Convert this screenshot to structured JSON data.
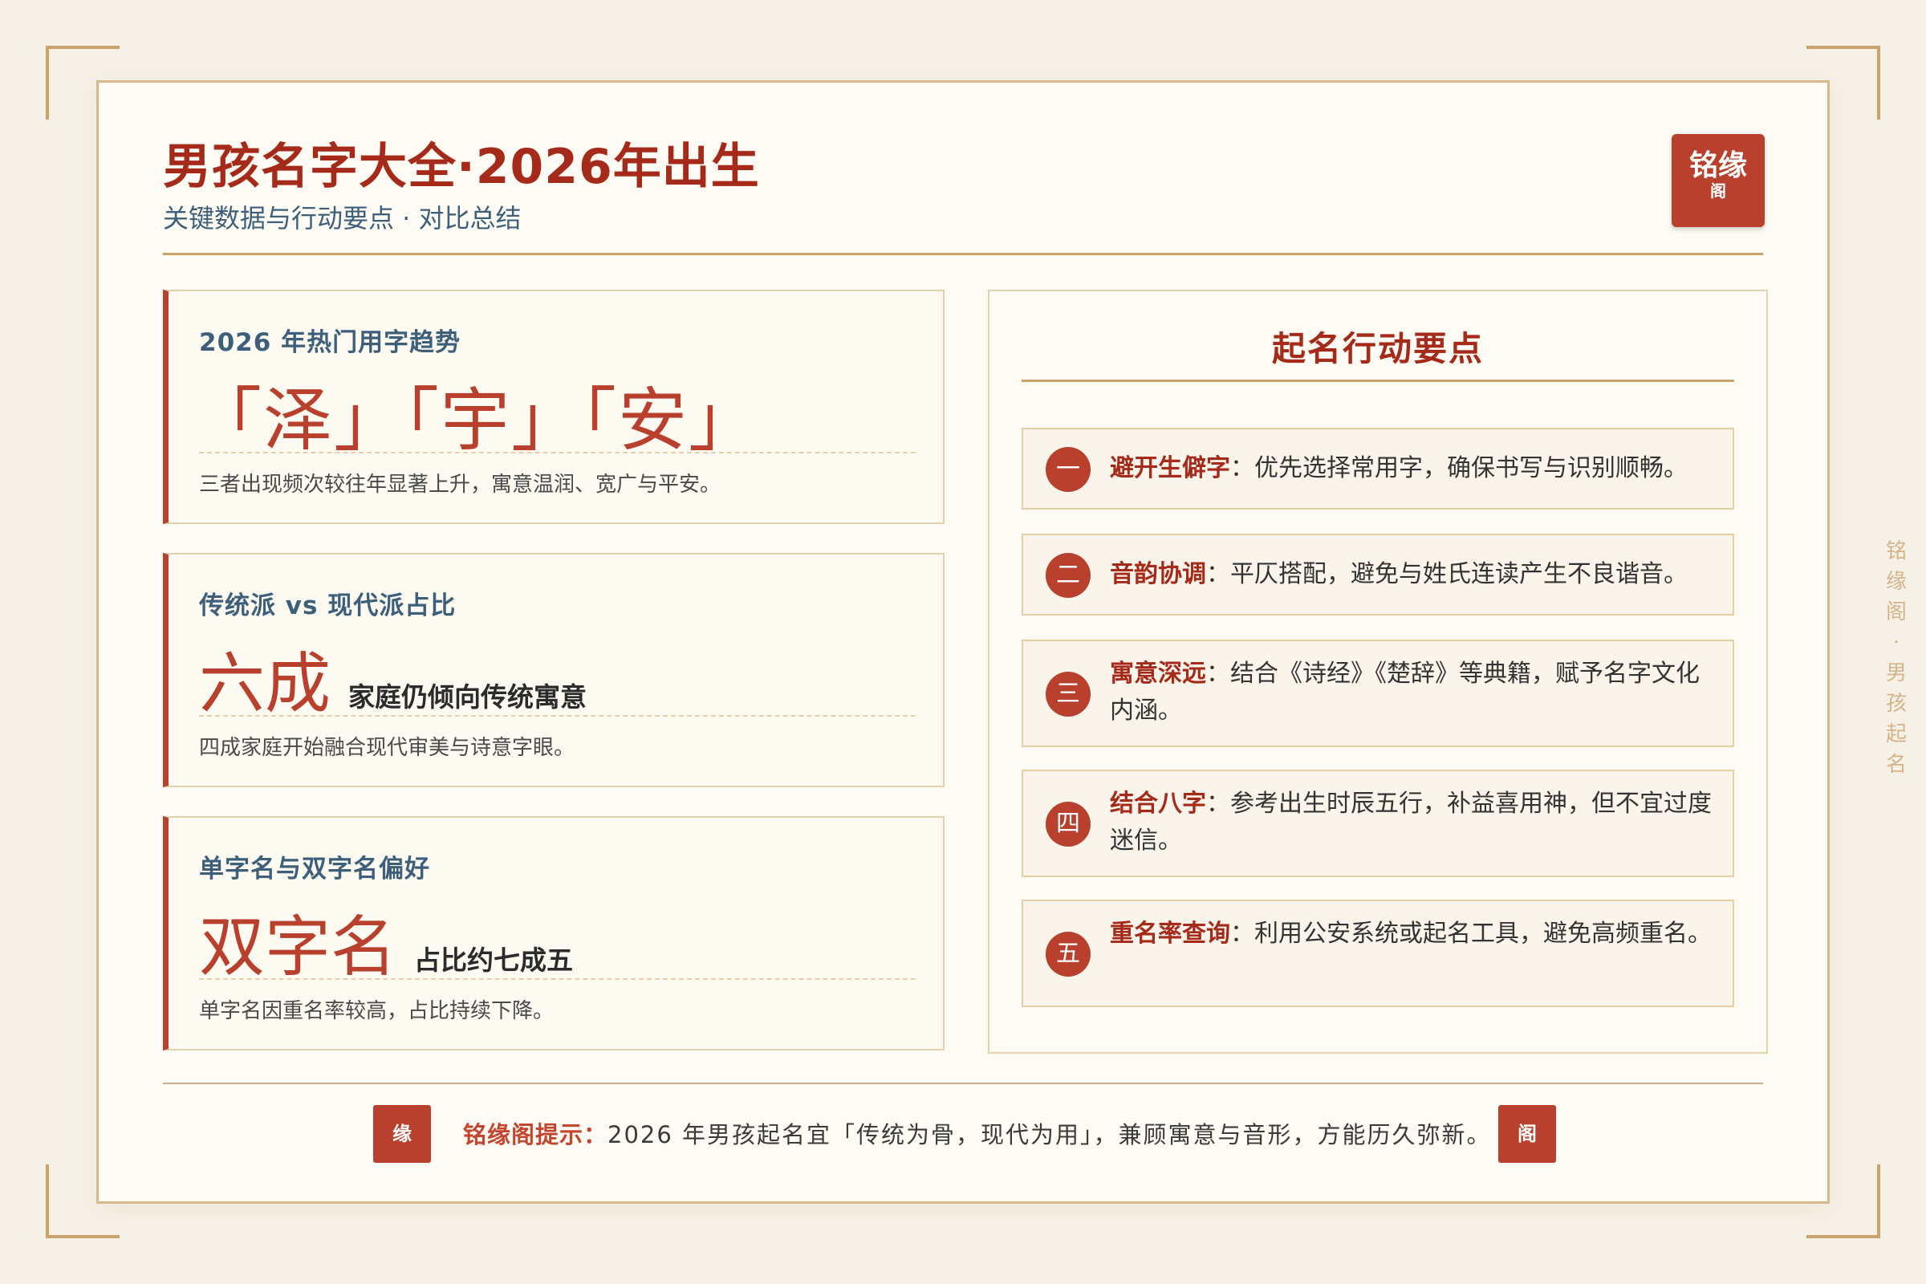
{
  "header": {
    "title": "男孩名字大全·2026年出生",
    "subtitle": "关键数据与行动要点 · 对比总结",
    "seal_main": "铭缘",
    "seal_small": "阁"
  },
  "stats": [
    {
      "label": "2026 年热门用字趋势",
      "big": "「泽」「宇」「安」",
      "note": "",
      "desc": "三者出现频次较往年显著上升，寓意温润、宽广与平安。"
    },
    {
      "label": "传统派 vs 现代派占比",
      "big": "六成",
      "note": "家庭仍倾向传统寓意",
      "desc": "四成家庭开始融合现代审美与诗意字眼。"
    },
    {
      "label": "单字名与双字名偏好",
      "big": "双字名",
      "note": "占比约七成五",
      "desc": "单字名因重名率较高，占比持续下降。"
    }
  ],
  "actions": {
    "title": "起名行动要点",
    "items": [
      {
        "num": "一",
        "key": "避开生僻字",
        "text": "：优先选择常用字，确保书写与识别顺畅。"
      },
      {
        "num": "二",
        "key": "音韵协调",
        "text": "：平仄搭配，避免与姓氏连读产生不良谐音。"
      },
      {
        "num": "三",
        "key": "寓意深远",
        "text": "：结合《诗经》《楚辞》等典籍，赋予名字文化内涵。"
      },
      {
        "num": "四",
        "key": "结合八字",
        "text": "：参考出生时辰五行，补益喜用神，但不宜过度迷信。"
      },
      {
        "num": "五",
        "key": "重名率查询",
        "text": "：利用公安系统或起名工具，避免高频重名。"
      }
    ]
  },
  "footer": {
    "seal_left": "缘",
    "seal_right": "阁",
    "lead": "铭缘阁提示：",
    "text": "2026 年男孩起名宜「传统为骨，现代为用」，兼顾寓意与音形，方能历久弥新。"
  },
  "side_text": [
    "铭",
    "缘",
    "阁",
    "·",
    "男",
    "孩",
    "起",
    "名"
  ],
  "colors": {
    "accent": "#b9402d",
    "title": "#a52a1a",
    "subtle": "#3d5f7a",
    "gold": "#c9a46a",
    "background": "#f6f1e7"
  }
}
